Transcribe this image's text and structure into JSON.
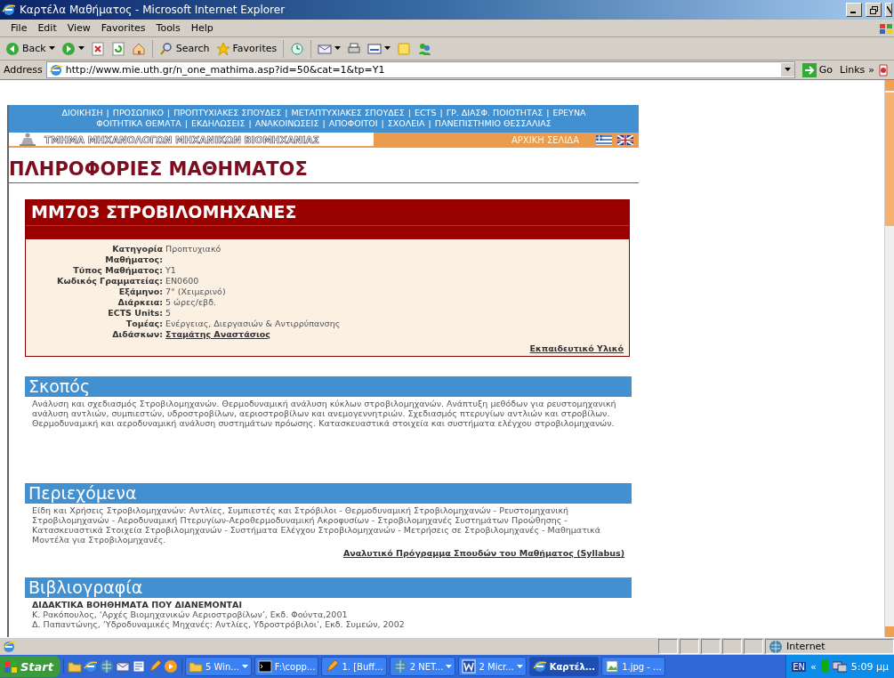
{
  "window": {
    "title": "Καρτέλα Μαθήματος - Microsoft Internet Explorer"
  },
  "menu": [
    "File",
    "Edit",
    "View",
    "Favorites",
    "Tools",
    "Help"
  ],
  "toolbar": [
    {
      "kind": "back",
      "label": "Back",
      "dropdown": true
    },
    {
      "kind": "forward",
      "dropdown": true
    },
    {
      "kind": "stop"
    },
    {
      "kind": "refresh"
    },
    {
      "kind": "home"
    },
    {
      "kind": "search",
      "label": "Search"
    },
    {
      "kind": "favorites",
      "label": "Favorites"
    },
    {
      "kind": "history"
    },
    {
      "kind": "mail",
      "dropdown": true
    },
    {
      "kind": "print"
    },
    {
      "kind": "edit",
      "dropdown": true
    },
    {
      "kind": "note"
    },
    {
      "kind": "messenger"
    }
  ],
  "address": {
    "label": "Address",
    "value": "http://www.mie.uth.gr/n_one_mathima.asp?id=50&cat=1&tp=Y1",
    "go": "Go",
    "links": "Links",
    "more": "»"
  },
  "page": {
    "nav_separator": "|",
    "nav_lines": [
      [
        "ΔΙΟΙΚΗΣΗ",
        "ΠΡΟΣΩΠΙΚΟ",
        "ΠΡΟΠΤΥΧΙΑΚΕΣ ΣΠΟΥΔΕΣ",
        "ΜΕΤΑΠΤΥΧΙΑΚΕΣ ΣΠΟΥΔΕΣ",
        "ECTS",
        "ΓΡ. ΔΙΑΣΦ. ΠΟΙΟΤΗΤΑΣ",
        "ΕΡΕΥΝΑ"
      ],
      [
        "ΦΟΙΤΗΤΙΚΑ ΘΕΜΑΤΑ",
        "ΕΚΔΗΛΩΣΕΙΣ",
        "ΑΝΑΚΟΙΝΩΣΕΙΣ",
        "ΑΠΟΦΟΙΤΟΙ",
        "ΣΧΟΛΕΙΑ",
        "ΠΑΝΕΠΙΣΤΗΜΙΟ ΘΕΣΣΑΛΙΑΣ"
      ]
    ],
    "department": "ΤΜΗΜΑ ΜΗΧΑΝΟΛΟΓΩΝ ΜΗΧΑΝΙΚΩΝ ΒΙΟΜΗΧΑΝΙΑΣ",
    "home_link": "ΑΡΧΙΚΗ ΣΕΛΙΔΑ",
    "heading": "ΠΛΗΡΟΦΟΡΙΕΣ ΜΑΘΗΜΑΤΟΣ",
    "course": {
      "title": "ΜΜ703 ΣΤΡΟΒΙΛΟΜΗΧΑΝΕΣ",
      "details": [
        {
          "label": "Κατηγορία Μαθήματος:",
          "value": "Προπτυχιακό",
          "kind": "text"
        },
        {
          "label": "Τύπος Μαθήματος:",
          "value": "Υ1",
          "kind": "text"
        },
        {
          "label": "Κωδικός Γραμματείας:",
          "value": "ΕΝ0600",
          "kind": "text"
        },
        {
          "label": "Εξάμηνο:",
          "value": "7° (Χειμερινό)",
          "kind": "text"
        },
        {
          "label": "Διάρκεια:",
          "value": "5 ώρες/εβδ.",
          "kind": "text"
        },
        {
          "label": "ECTS Units:",
          "value": "5",
          "kind": "text"
        },
        {
          "label": "Τομέας:",
          "value": "Ενέργειας, Διεργασιών & Αντιρρύπανσης",
          "kind": "text"
        },
        {
          "label": "Διδάσκων:",
          "value": "Σταμάτης Αναστάσιος",
          "kind": "link"
        }
      ],
      "materials_link": "Εκπαιδευτικό Υλικό"
    },
    "sections": [
      {
        "heading": "Σκοπός",
        "lines": [
          "Ανάλυση και σχεδιασμός Στροβιλομηχανών. Θερμοδυναμική ανάλυση κύκλων στροβιλομηχανών. Ανάπτυξη μεθόδων για ρευστομηχανική ανάλυση αντλιών, συμπιεστών, υδροστροβίλων, αεριοστροβίλων και ανεμογεννητριών.  Σχεδιασμός πτερυγίων αντλιών και στροβίλων.  Θερμοδυναμική και αεροδυναμική ανάλυση συστημάτων πρόωσης. Κατασκευαστικά στοιχεία και συστήματα ελέγχου στροβιλομηχανών."
        ]
      },
      {
        "heading": "Περιεχόμενα",
        "lines": [
          "Είδη και Χρήσεις Στροβιλομηχανών: Αντλίες, Συμπιεστές και Στρόβιλοι - Θερμοδυναμική Στροβιλομηχανών - Ρευστομηχανική Στροβιλομηχανών - Αεροδυναμική Πτερυγίων-Αεροθερμοδυναμική Ακροφυσίων - Στροβιλομηχανές Συστημάτων Προώθησης - Κατασκευαστικά Στοιχεία Στροβιλομηχανών - Συστήματα Ελέγχου Στροβιλομηχανών - Μετρήσεις σε Στροβιλομηχανές - Μαθηματικά Μοντέλα για Στροβιλομηχανές."
        ],
        "link": "Αναλυτικό Πρόγραμμα Σπουδών του Μαθήματος (Syllabus)"
      },
      {
        "heading": "Βιβλιογραφία",
        "subheading": "ΔΙΔΑΚΤΙΚΑ ΒΟΗΘΗΜΑΤΑ ΠΟΥ ΔΙΑΝΕΜΟΝΤΑΙ",
        "lines": [
          "Κ. Ρακόπουλος, ‘Αρχές Βιομηχανικών Αεριοστροβίλων’, Εκδ. Φούντα,2001",
          "Δ. Παπαντώνης, ‘Υδροδυναμικές Μηχανές: Αντλίες, Υδροστρόβιλοι’, Εκδ. Συμεών, 2002"
        ]
      }
    ]
  },
  "status_bar": {
    "zone": "Internet"
  },
  "taskbar": {
    "start": "Start",
    "tasks": [
      {
        "label": "5 Win...",
        "kind": "folder",
        "dropdown": true,
        "selected": false
      },
      {
        "label": "F:\\copp...",
        "kind": "console",
        "dropdown": false,
        "selected": false
      },
      {
        "label": "1. [Buff...",
        "kind": "pencil",
        "dropdown": false,
        "selected": false
      },
      {
        "label": "2 NET...",
        "kind": "globe",
        "dropdown": true,
        "selected": false
      },
      {
        "label": "2 Micr...",
        "kind": "word",
        "dropdown": true,
        "selected": false
      },
      {
        "label": "Καρτέλ...",
        "kind": "ie",
        "dropdown": false,
        "selected": true
      },
      {
        "label": "1.jpg - ...",
        "kind": "image",
        "dropdown": false,
        "selected": false
      }
    ],
    "language": "EN",
    "chevron": "«",
    "time": "5:09 μμ"
  }
}
